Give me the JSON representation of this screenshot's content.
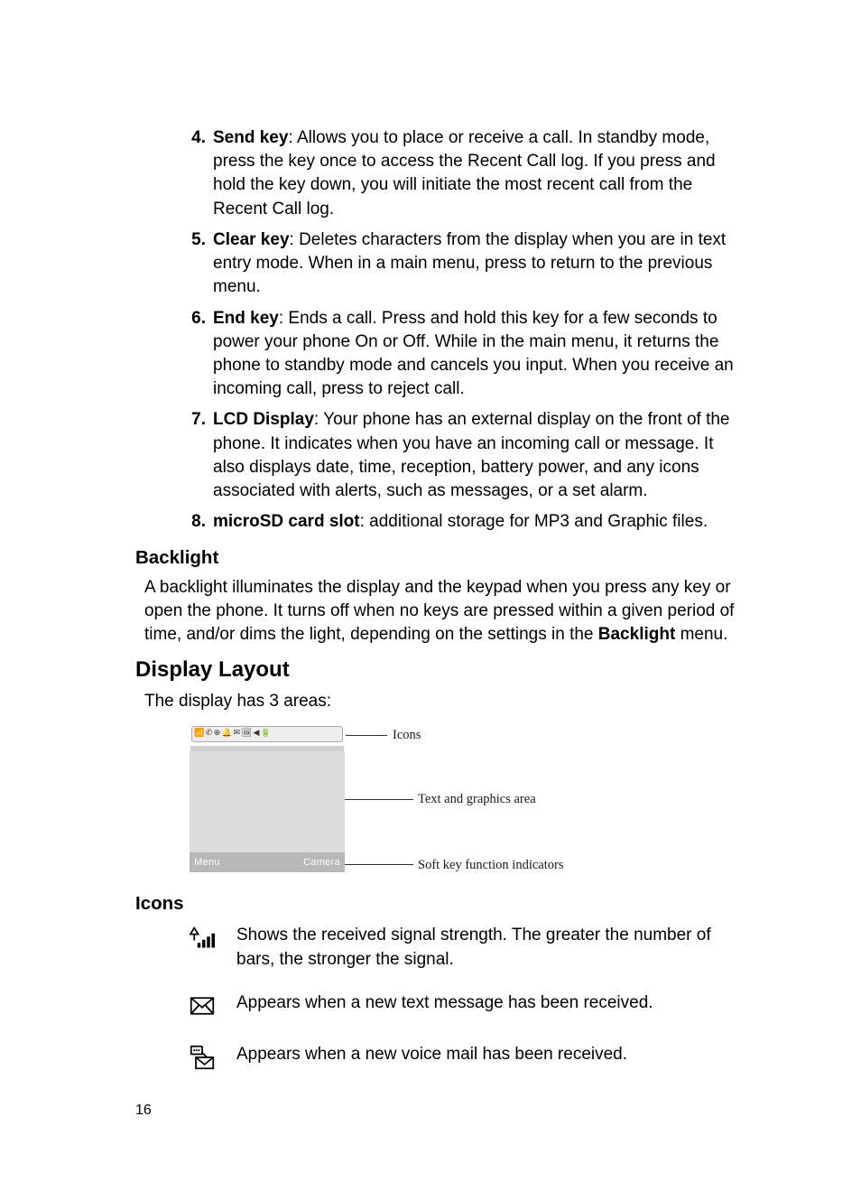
{
  "list": {
    "item4": {
      "num": "4.",
      "term": "Send key",
      "text": ": Allows you to place or receive a call. In standby mode, press the key once to access the Recent Call log. If you press and hold the key down, you will initiate the most recent call from the Recent Call log."
    },
    "item5": {
      "num": "5.",
      "term": "Clear key",
      "text": ": Deletes characters from the display when you are in text entry mode. When in a main menu, press to return to the previous menu."
    },
    "item6": {
      "num": "6.",
      "term": "End key",
      "text": ": Ends a call. Press and hold this key for a few seconds to power your phone On or Off. While in the main menu, it returns the phone to standby mode and cancels you input. When you receive an incoming call, press to reject call."
    },
    "item7": {
      "num": "7.",
      "term": "LCD Display",
      "text": ": Your phone has an external display on the front of the phone. It indicates when you have an incoming call or message. It also displays date, time, reception, battery power, and any icons associated with alerts, such as messages, or a set alarm."
    },
    "item8": {
      "num": "8.",
      "term": "microSD card slot",
      "text": ": additional storage for MP3 and Graphic files."
    }
  },
  "backlight": {
    "heading": "Backlight",
    "para_a": "A backlight illuminates the display and the keypad when you press any key or open the phone. It turns off when no keys are pressed within a given period of time, and/or dims the light, depending on the settings in the ",
    "para_bold": "Backlight",
    "para_b": " menu."
  },
  "display_layout": {
    "heading": "Display Layout",
    "intro": "The display has 3 areas:",
    "labels": {
      "icons": "Icons",
      "text_area": "Text and graphics area",
      "softkeys": "Soft key function indicators"
    },
    "softkey_left": "Menu",
    "softkey_right": "Camera"
  },
  "icons_section": {
    "heading": "Icons",
    "rows": {
      "signal": "Shows the received signal strength. The greater the number of bars, the stronger the signal.",
      "text_msg": "Appears when a new text message has been received.",
      "voicemail": "Appears when a new voice mail has been received."
    }
  },
  "page_number": "16"
}
